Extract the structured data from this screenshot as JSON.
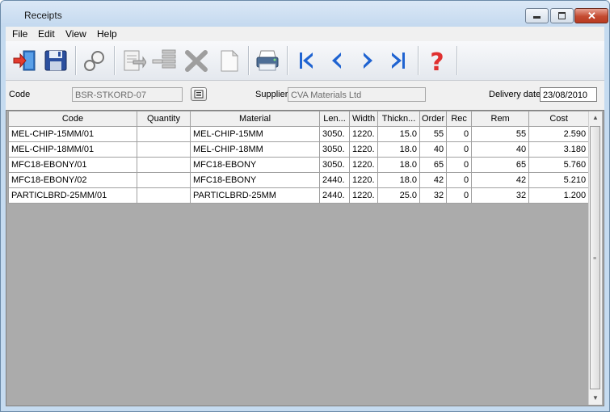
{
  "window": {
    "title": "Receipts"
  },
  "menu": [
    "File",
    "Edit",
    "View",
    "Help"
  ],
  "toolbar_icons": [
    "exit-icon",
    "save-icon",
    "search-icon",
    "edit-icon",
    "list-icon",
    "delete-icon",
    "new-icon",
    "print-icon",
    "first-record-icon",
    "previous-record-icon",
    "next-record-icon",
    "last-record-icon",
    "help-icon"
  ],
  "form": {
    "code_label": "Code",
    "code_value": "BSR-STKORD-07",
    "supplier_label": "Supplier",
    "supplier_value": "CVA Materials Ltd",
    "delivery_label": "Delivery date",
    "delivery_value": "23/08/2010"
  },
  "table": {
    "headers": [
      "Code",
      "Quantity",
      "Material",
      "Len...",
      "Width",
      "Thickn...",
      "Order",
      "Rec",
      "Rem",
      "Cost"
    ],
    "rows": [
      [
        "MEL-CHIP-15MM/01",
        "",
        "MEL-CHIP-15MM",
        "3050.",
        "1220.",
        "15.0",
        "55",
        "0",
        "55",
        "2.590"
      ],
      [
        "MEL-CHIP-18MM/01",
        "",
        "MEL-CHIP-18MM",
        "3050.",
        "1220.",
        "18.0",
        "40",
        "0",
        "40",
        "3.180"
      ],
      [
        "MFC18-EBONY/01",
        "",
        "MFC18-EBONY",
        "3050.",
        "1220.",
        "18.0",
        "65",
        "0",
        "65",
        "5.760"
      ],
      [
        "MFC18-EBONY/02",
        "",
        "MFC18-EBONY",
        "2440.",
        "1220.",
        "18.0",
        "42",
        "0",
        "42",
        "5.210"
      ],
      [
        "PARTICLBRD-25MM/01",
        "",
        "PARTICLBRD-25MM",
        "2440.",
        "1220.",
        "25.0",
        "32",
        "0",
        "32",
        "1.200"
      ]
    ]
  }
}
